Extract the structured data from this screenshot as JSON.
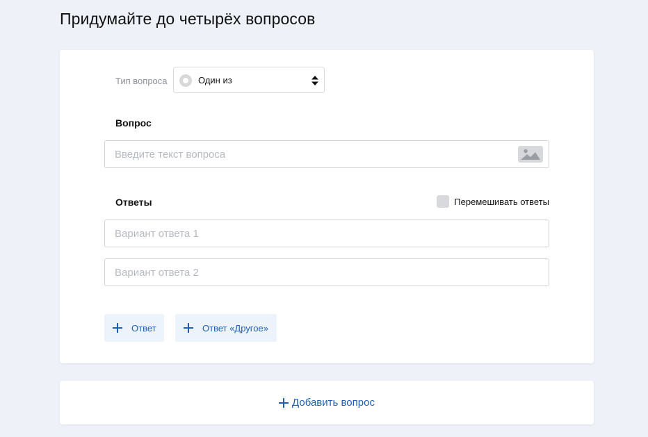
{
  "page": {
    "title": "Придумайте до четырёх вопросов"
  },
  "question": {
    "type_label": "Тип вопроса",
    "type_value": "Один из",
    "section_label": "Вопрос",
    "input_placeholder": "Введите текст вопроса",
    "input_value": ""
  },
  "answers": {
    "section_label": "Ответы",
    "shuffle_label": "Перемешивать ответы",
    "shuffle_checked": false,
    "items": [
      {
        "placeholder": "Вариант ответа 1",
        "value": ""
      },
      {
        "placeholder": "Вариант ответа 2",
        "value": ""
      }
    ],
    "add_answer_label": "Ответ",
    "add_other_label": "Ответ «Другое»"
  },
  "footer": {
    "add_question_label": "Добавить вопрос"
  },
  "icons": {
    "radio": "radio-icon",
    "select_arrows": "updown-arrows-icon",
    "image": "image-icon",
    "plus": "plus-icon"
  },
  "colors": {
    "accent": "#1f5fb3",
    "page_bg": "#eef2f8",
    "soft_button_bg": "#edf3fa"
  }
}
